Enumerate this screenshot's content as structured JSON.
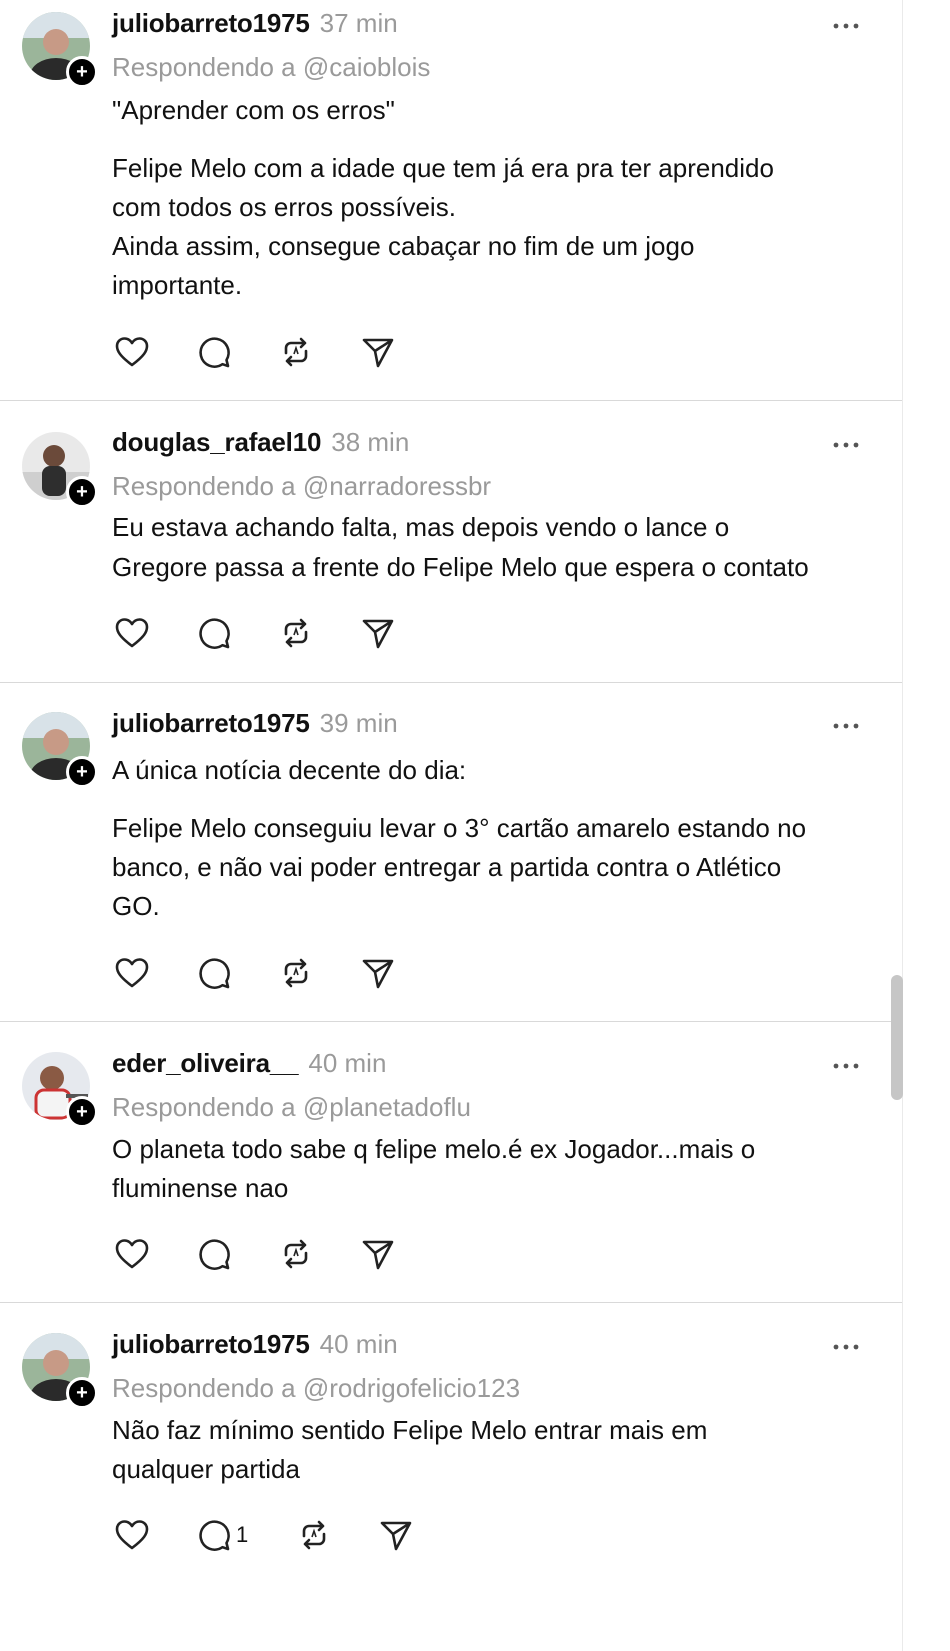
{
  "posts": [
    {
      "username": "juliobarreto1975",
      "time": "37 min",
      "reply_prefix": "Respondendo a",
      "reply_to": "@caioblois",
      "lines": [
        "\"Aprender com os erros\"",
        "Felipe Melo com a idade que tem já era pra ter aprendido",
        "com todos os erros possíveis.",
        "Ainda assim, consegue cabaçar no fim de um jogo",
        "importante."
      ],
      "avatar_icon": "avatar-photo"
    },
    {
      "username": "douglas_rafael10",
      "time": "38 min",
      "reply_prefix": "Respondendo a",
      "reply_to": "@narradoressbr",
      "lines": [
        "Eu estava achando falta, mas depois vendo o lance o",
        "Gregore passa a frente do Felipe Melo que espera o contato"
      ],
      "avatar_icon": "avatar-photo"
    },
    {
      "username": "juliobarreto1975",
      "time": "39 min",
      "lines": [
        "A única notícia decente do dia:",
        "Felipe Melo conseguiu levar o 3° cartão amarelo estando no",
        "banco, e não vai poder entregar a partida contra o Atlético",
        "GO."
      ],
      "avatar_icon": "avatar-photo"
    },
    {
      "username": "eder_oliveira__",
      "time": "40 min",
      "reply_prefix": "Respondendo a",
      "reply_to": "@planetadoflu",
      "lines": [
        "O planeta todo sabe q felipe melo.é ex Jogador...mais o",
        "fluminense nao"
      ],
      "avatar_icon": "avatar-photo"
    },
    {
      "username": "juliobarreto1975",
      "time": "40 min",
      "reply_prefix": "Respondendo a",
      "reply_to": "@rodrigofelicio123",
      "lines": [
        "Não faz mínimo sentido Felipe Melo entrar mais em",
        "qualquer partida"
      ],
      "reply_count": "1",
      "avatar_icon": "avatar-photo"
    }
  ],
  "icons": {
    "like": "heart-icon",
    "comment": "comment-icon",
    "repost": "repost-icon",
    "share": "share-icon",
    "more": "more-icon",
    "follow": "plus-icon"
  },
  "follow_badge": "+",
  "colors": {
    "text": "#111111",
    "muted": "#9a9a9a",
    "divider": "#d9d9d9"
  }
}
